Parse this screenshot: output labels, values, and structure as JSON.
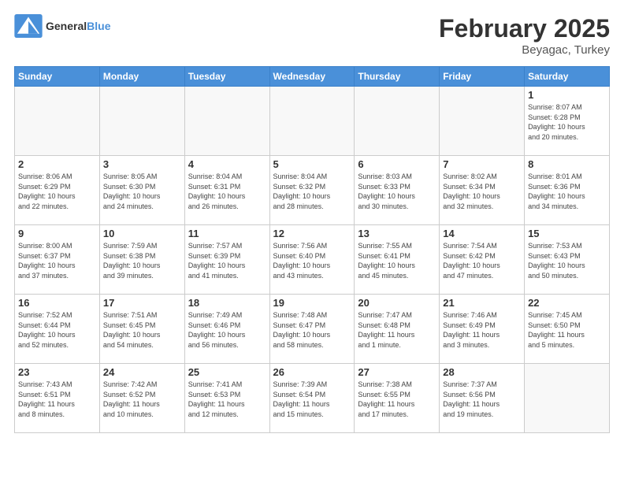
{
  "header": {
    "logo_general": "General",
    "logo_blue": "Blue",
    "month_title": "February 2025",
    "location": "Beyagac, Turkey"
  },
  "weekdays": [
    "Sunday",
    "Monday",
    "Tuesday",
    "Wednesday",
    "Thursday",
    "Friday",
    "Saturday"
  ],
  "weeks": [
    [
      {
        "day": "",
        "info": ""
      },
      {
        "day": "",
        "info": ""
      },
      {
        "day": "",
        "info": ""
      },
      {
        "day": "",
        "info": ""
      },
      {
        "day": "",
        "info": ""
      },
      {
        "day": "",
        "info": ""
      },
      {
        "day": "1",
        "info": "Sunrise: 8:07 AM\nSunset: 6:28 PM\nDaylight: 10 hours\nand 20 minutes."
      }
    ],
    [
      {
        "day": "2",
        "info": "Sunrise: 8:06 AM\nSunset: 6:29 PM\nDaylight: 10 hours\nand 22 minutes."
      },
      {
        "day": "3",
        "info": "Sunrise: 8:05 AM\nSunset: 6:30 PM\nDaylight: 10 hours\nand 24 minutes."
      },
      {
        "day": "4",
        "info": "Sunrise: 8:04 AM\nSunset: 6:31 PM\nDaylight: 10 hours\nand 26 minutes."
      },
      {
        "day": "5",
        "info": "Sunrise: 8:04 AM\nSunset: 6:32 PM\nDaylight: 10 hours\nand 28 minutes."
      },
      {
        "day": "6",
        "info": "Sunrise: 8:03 AM\nSunset: 6:33 PM\nDaylight: 10 hours\nand 30 minutes."
      },
      {
        "day": "7",
        "info": "Sunrise: 8:02 AM\nSunset: 6:34 PM\nDaylight: 10 hours\nand 32 minutes."
      },
      {
        "day": "8",
        "info": "Sunrise: 8:01 AM\nSunset: 6:36 PM\nDaylight: 10 hours\nand 34 minutes."
      }
    ],
    [
      {
        "day": "9",
        "info": "Sunrise: 8:00 AM\nSunset: 6:37 PM\nDaylight: 10 hours\nand 37 minutes."
      },
      {
        "day": "10",
        "info": "Sunrise: 7:59 AM\nSunset: 6:38 PM\nDaylight: 10 hours\nand 39 minutes."
      },
      {
        "day": "11",
        "info": "Sunrise: 7:57 AM\nSunset: 6:39 PM\nDaylight: 10 hours\nand 41 minutes."
      },
      {
        "day": "12",
        "info": "Sunrise: 7:56 AM\nSunset: 6:40 PM\nDaylight: 10 hours\nand 43 minutes."
      },
      {
        "day": "13",
        "info": "Sunrise: 7:55 AM\nSunset: 6:41 PM\nDaylight: 10 hours\nand 45 minutes."
      },
      {
        "day": "14",
        "info": "Sunrise: 7:54 AM\nSunset: 6:42 PM\nDaylight: 10 hours\nand 47 minutes."
      },
      {
        "day": "15",
        "info": "Sunrise: 7:53 AM\nSunset: 6:43 PM\nDaylight: 10 hours\nand 50 minutes."
      }
    ],
    [
      {
        "day": "16",
        "info": "Sunrise: 7:52 AM\nSunset: 6:44 PM\nDaylight: 10 hours\nand 52 minutes."
      },
      {
        "day": "17",
        "info": "Sunrise: 7:51 AM\nSunset: 6:45 PM\nDaylight: 10 hours\nand 54 minutes."
      },
      {
        "day": "18",
        "info": "Sunrise: 7:49 AM\nSunset: 6:46 PM\nDaylight: 10 hours\nand 56 minutes."
      },
      {
        "day": "19",
        "info": "Sunrise: 7:48 AM\nSunset: 6:47 PM\nDaylight: 10 hours\nand 58 minutes."
      },
      {
        "day": "20",
        "info": "Sunrise: 7:47 AM\nSunset: 6:48 PM\nDaylight: 11 hours\nand 1 minute."
      },
      {
        "day": "21",
        "info": "Sunrise: 7:46 AM\nSunset: 6:49 PM\nDaylight: 11 hours\nand 3 minutes."
      },
      {
        "day": "22",
        "info": "Sunrise: 7:45 AM\nSunset: 6:50 PM\nDaylight: 11 hours\nand 5 minutes."
      }
    ],
    [
      {
        "day": "23",
        "info": "Sunrise: 7:43 AM\nSunset: 6:51 PM\nDaylight: 11 hours\nand 8 minutes."
      },
      {
        "day": "24",
        "info": "Sunrise: 7:42 AM\nSunset: 6:52 PM\nDaylight: 11 hours\nand 10 minutes."
      },
      {
        "day": "25",
        "info": "Sunrise: 7:41 AM\nSunset: 6:53 PM\nDaylight: 11 hours\nand 12 minutes."
      },
      {
        "day": "26",
        "info": "Sunrise: 7:39 AM\nSunset: 6:54 PM\nDaylight: 11 hours\nand 15 minutes."
      },
      {
        "day": "27",
        "info": "Sunrise: 7:38 AM\nSunset: 6:55 PM\nDaylight: 11 hours\nand 17 minutes."
      },
      {
        "day": "28",
        "info": "Sunrise: 7:37 AM\nSunset: 6:56 PM\nDaylight: 11 hours\nand 19 minutes."
      },
      {
        "day": "",
        "info": ""
      }
    ]
  ]
}
